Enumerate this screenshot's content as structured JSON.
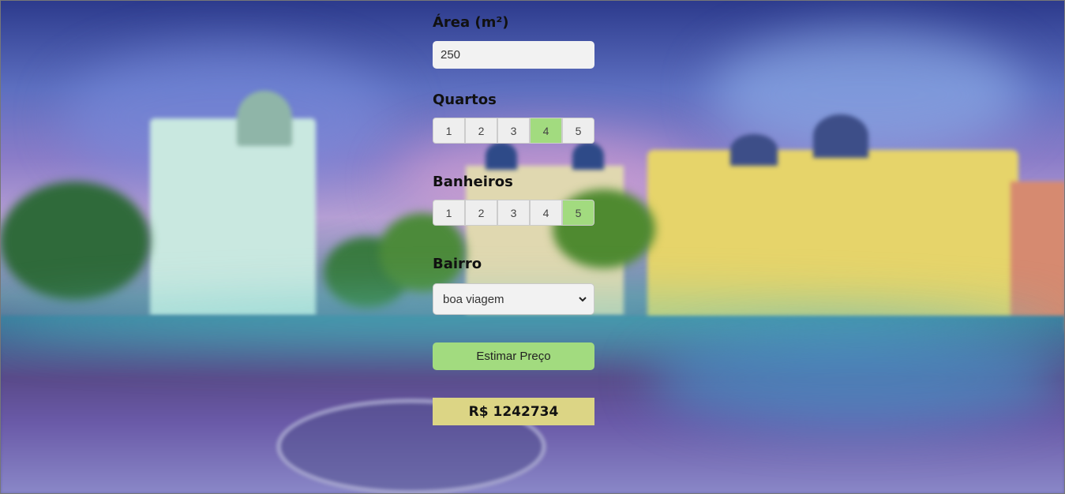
{
  "form": {
    "area": {
      "label": "Área (m²)",
      "value": "250"
    },
    "quartos": {
      "label": "Quartos",
      "options": [
        "1",
        "2",
        "3",
        "4",
        "5"
      ],
      "selected": "4"
    },
    "banheiros": {
      "label": "Banheiros",
      "options": [
        "1",
        "2",
        "3",
        "4",
        "5"
      ],
      "selected": "5"
    },
    "bairro": {
      "label": "Bairro",
      "selected": "boa viagem"
    },
    "estimate_button": "Estimar Preço",
    "result": "R$ 1242734"
  },
  "icons": {
    "select_arrow": "chevron-down-icon"
  },
  "colors": {
    "active_option": "#a2db7f",
    "button": "#a2db7f",
    "result_bg": "#dcd585",
    "input_bg": "#f2f2f2"
  }
}
